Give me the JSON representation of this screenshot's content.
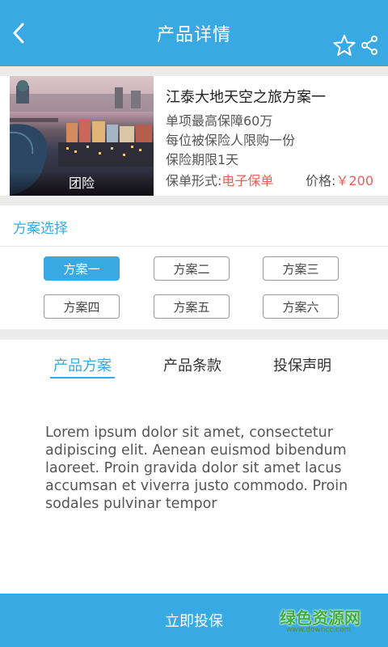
{
  "header": {
    "title": "产品详情",
    "back_icon": "chevron-left-icon",
    "favorite_icon": "star-icon",
    "share_icon": "share-icon"
  },
  "product": {
    "tag": "团险",
    "name": "江泰大地天空之旅方案一",
    "features": [
      "单项最高保障60万",
      "每位被保险人限购一份",
      "保险期限1天"
    ],
    "policy_form_label": "保单形式:",
    "policy_form_value": "电子保单",
    "price_label": "价格:",
    "price_value": "￥200"
  },
  "plans": {
    "title": "方案选择",
    "options": [
      "方案一",
      "方案二",
      "方案三",
      "方案四",
      "方案五",
      "方案六"
    ],
    "selected": "方案一"
  },
  "tabs": {
    "items": [
      "产品方案",
      "产品条款",
      "投保声明"
    ],
    "active": "产品方案"
  },
  "content": {
    "body": "Lorem ipsum dolor sit amet, consectetur adipiscing elit. Aenean euismod bibendum laoreet. Proin gravida dolor sit amet lacus accumsan et viverra justo commodo. Proin sodales pulvinar tempor"
  },
  "footer": {
    "action_label": "立即投保",
    "watermark_title": "绿色资源网",
    "watermark_url": "www.downcc.com"
  },
  "colors": {
    "accent": "#38a9e3",
    "price_red": "#f25c54",
    "separator": "#ececec"
  }
}
